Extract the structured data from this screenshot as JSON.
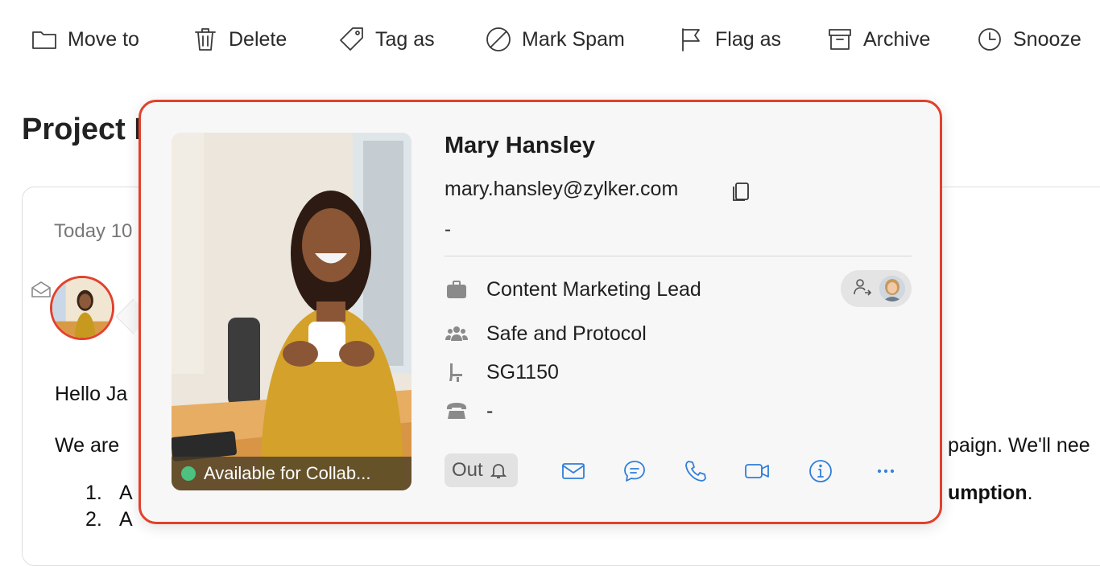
{
  "toolbar": {
    "items": [
      {
        "label": "Move to",
        "icon": "folder-icon"
      },
      {
        "label": "Delete",
        "icon": "trash-icon"
      },
      {
        "label": "Tag as",
        "icon": "tag-icon"
      },
      {
        "label": "Mark Spam",
        "icon": "spam-icon"
      },
      {
        "label": "Flag as",
        "icon": "flag-icon"
      },
      {
        "label": "Archive",
        "icon": "archive-icon"
      },
      {
        "label": "Snooze",
        "icon": "clock-icon"
      }
    ]
  },
  "email": {
    "subject": "Project B",
    "date": "Today 10",
    "greeting": "Hello Ja",
    "para1_start": "We are",
    "para1_end": "paign. We'll nee",
    "list": [
      {
        "num": "1.",
        "start": "A",
        "end_bold": "umption",
        "end_suffix": "."
      },
      {
        "num": "2.",
        "start": "A"
      }
    ]
  },
  "contact": {
    "name": "Mary Hansley",
    "email": "mary.hansley@zylker.com",
    "secondary": "-",
    "status": "Available for Collab...",
    "status_color": "#4dc17f",
    "title": "Content Marketing Lead",
    "department": "Safe and Protocol",
    "seat": "SG1150",
    "phone": "-",
    "out_label": "Out"
  },
  "colors": {
    "accent": "#2f7ed8",
    "highlight_border": "#e0412c"
  }
}
